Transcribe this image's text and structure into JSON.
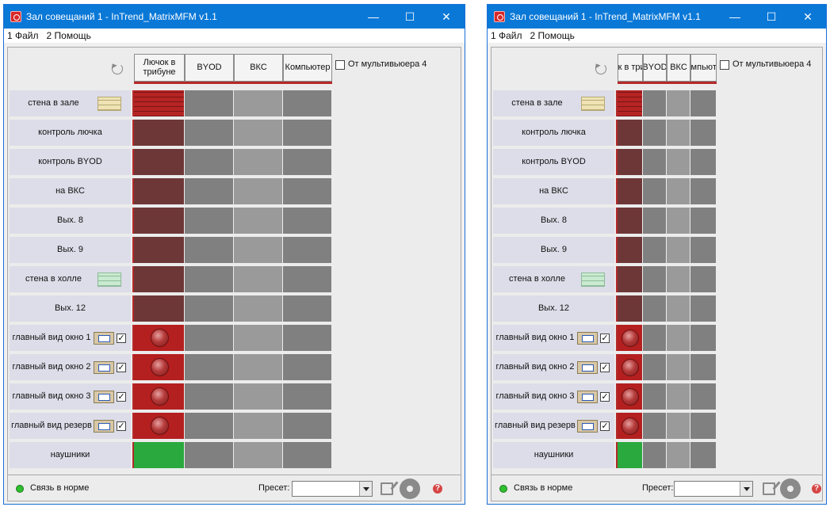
{
  "windows": [
    {
      "id": "window-wide",
      "title": "Зал совещаний 1 - InTrend_MatrixMFM v1.1",
      "menu": [
        "1 Файл",
        "2 Помощь"
      ],
      "columns": [
        "Лючок в трибуне",
        "BYOD",
        "ВКС",
        "Компьютер"
      ],
      "multiviewer_label": "От мультивьюера 4",
      "status_text": "Связь в норме",
      "preset_label": "Пресет:",
      "preset_value": ""
    },
    {
      "id": "window-narrow",
      "title": "Зал совещаний 1 - InTrend_MatrixMFM v1.1",
      "menu": [
        "1 Файл",
        "2 Помощь"
      ],
      "columns": [
        "Лючок в трибуне",
        "BYOD",
        "ВКС",
        "Компьютер"
      ],
      "multiviewer_label": "От мультивьюера 4",
      "status_text": "Связь в норме",
      "preset_label": "Пресет:",
      "preset_value": ""
    }
  ],
  "rows": [
    {
      "label": "стена в зале",
      "icon": "wall-icon-yellow",
      "active": "bricks"
    },
    {
      "label": "контроль лючка",
      "icon": "",
      "active": "dark"
    },
    {
      "label": "контроль BYOD",
      "icon": "",
      "active": "dark"
    },
    {
      "label": "на ВКС",
      "icon": "",
      "active": "dark"
    },
    {
      "label": "Вых. 8",
      "icon": "",
      "active": "dark"
    },
    {
      "label": "Вых. 9",
      "icon": "",
      "active": "dark"
    },
    {
      "label": "стена в холле",
      "icon": "wall-icon-green",
      "active": "dark"
    },
    {
      "label": "Вых. 12",
      "icon": "",
      "active": "dark"
    },
    {
      "label": "главный вид окно 1",
      "icon": "screen-icon",
      "checked": true,
      "active": "red-led"
    },
    {
      "label": "главный вид окно 2",
      "icon": "screen-icon",
      "checked": true,
      "active": "red-led"
    },
    {
      "label": "главный вид окно 3",
      "icon": "screen-icon",
      "checked": true,
      "active": "red-led"
    },
    {
      "label": "главный вид резерв",
      "icon": "screen-icon",
      "checked": true,
      "active": "red-led"
    },
    {
      "label": "наушники",
      "icon": "",
      "active": "green"
    }
  ],
  "colors": {
    "titlebar": "#0a78d7",
    "active_route": "#6e3737",
    "active_red": "#b41f1f",
    "active_green": "#2aa93e",
    "status_ok": "#2fbf2f"
  }
}
